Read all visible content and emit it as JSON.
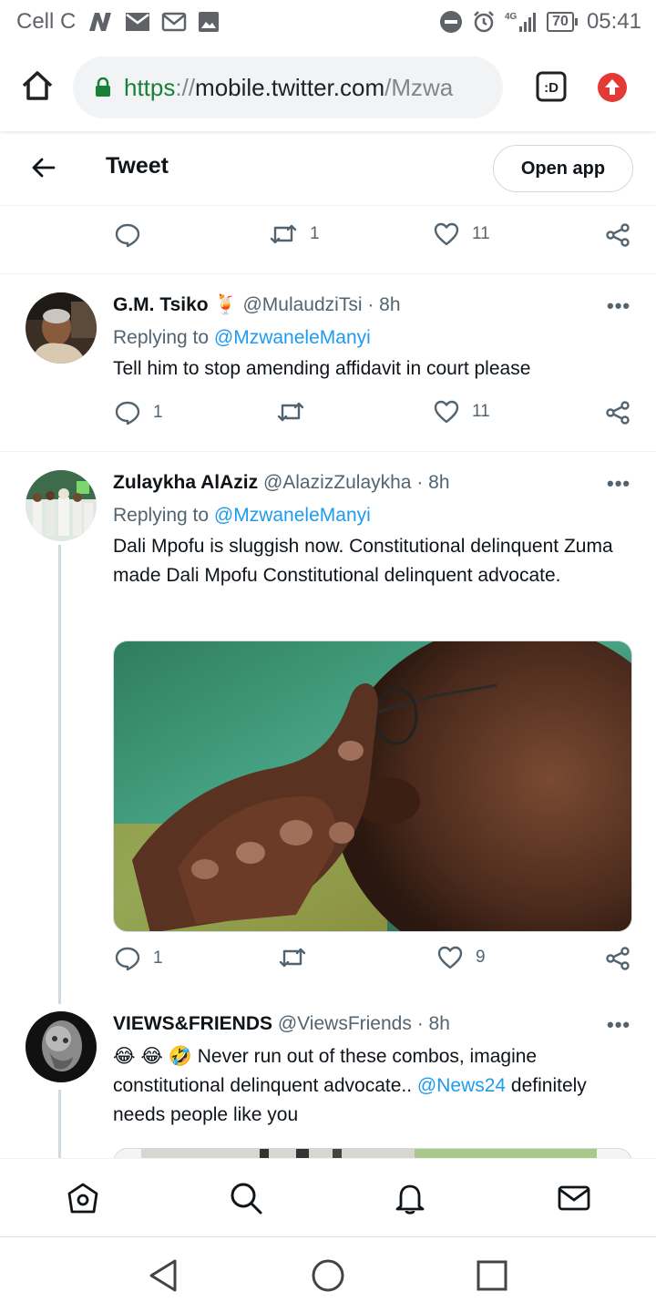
{
  "status_bar": {
    "carrier": "Cell C",
    "network": "4G",
    "battery": "70",
    "time": "05:41"
  },
  "browser": {
    "url_scheme": "https",
    "url_sep": "://",
    "url_host": "mobile.twitter.com",
    "url_path": "/Mzwa",
    "tab_label": ":D"
  },
  "header": {
    "title": "Tweet",
    "open_app": "Open app"
  },
  "top_actions": {
    "reply_count": "",
    "retweet_count": "1",
    "like_count": "11"
  },
  "tweets": [
    {
      "name": "G.M. Tsiko",
      "emoji": "🍹",
      "handle": "@MulaudziTsi",
      "time": "· 8h",
      "replying_prefix": "Replying to",
      "replying_to": "@MzwaneleManyi",
      "text": "Tell him to stop amending affidavit in court please",
      "reply_count": "1",
      "retweet_count": "",
      "like_count": "11"
    },
    {
      "name": "Zulaykha AlAziz",
      "handle": "@AlazizZulaykha",
      "time": "· 8h",
      "replying_prefix": "Replying to",
      "replying_to": "@MzwaneleManyi",
      "text": "Dali Mpofu is sluggish now. Constitutional delinquent Zuma made Dali Mpofu Constitutional delinquent advocate.",
      "reply_count": "1",
      "retweet_count": "",
      "like_count": "9"
    },
    {
      "name": "VIEWS&FRIENDS",
      "handle": "@ViewsFriends",
      "time": "· 8h",
      "emojis": "😂 😂 🤣",
      "text_before": " Never run out of these combos, imagine constitutional delinquent advocate.. ",
      "mention": "@News24",
      "text_after": " definitely needs people like you"
    }
  ],
  "more_label": "•••",
  "colors": {
    "accent": "#1d9bf0",
    "text_primary": "#0f1419",
    "text_secondary": "#536471",
    "url_green": "#188038",
    "update_red": "#e53935"
  },
  "icons": [
    "home-icon",
    "search-icon",
    "bell-icon",
    "mail-icon",
    "back-icon",
    "circle-home-icon",
    "square-recents-icon"
  ]
}
